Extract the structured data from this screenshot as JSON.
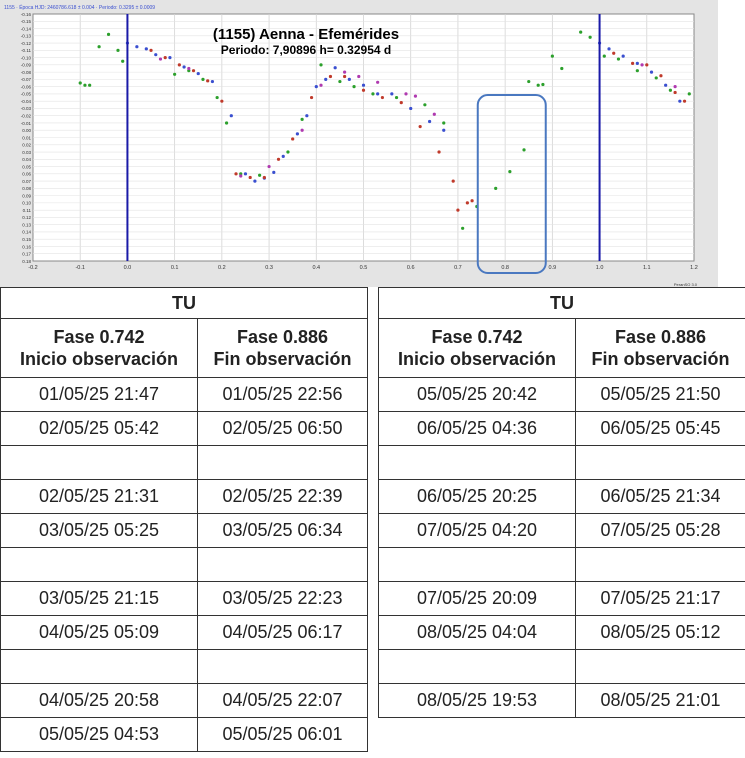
{
  "chart_data": {
    "type": "scatter",
    "title": "(1155) Aenna - Efemérides",
    "subtitle": "Periodo: 7,90896 h= 0.32954 d",
    "header_text": "1155 · Época HJD: 2460786.618 ± 0.004 · Periodo: 0.3295 ± 0.0009",
    "footer_text": "PeranSO 3.0",
    "xlim": [
      -0.2,
      1.2
    ],
    "ylim": [
      -0.16,
      0.18
    ],
    "x_ticks": [
      "-0.2",
      "-0.1",
      "0.0",
      "0.1",
      "0.2",
      "0.3",
      "0.4",
      "0.5",
      "0.6",
      "0.7",
      "0.8",
      "0.9",
      "1.0",
      "1.1",
      "1.2"
    ],
    "y_ticks": [
      "-0.16",
      "-0.15",
      "-0.14",
      "-0.13",
      "-0.12",
      "-0.11",
      "-0.10",
      "-0.09",
      "-0.08",
      "-0.07",
      "-0.06",
      "-0.05",
      "-0.04",
      "-0.03",
      "-0.02",
      "-0.01",
      "0.00",
      "0.01",
      "0.02",
      "0.03",
      "0.04",
      "0.05",
      "0.06",
      "0.07",
      "0.08",
      "0.09",
      "0.10",
      "0.11",
      "0.12",
      "0.13",
      "0.14",
      "0.15",
      "0.16",
      "0.17",
      "0.18"
    ],
    "vertical_lines": [
      0.0,
      1.0
    ],
    "highlight_box": {
      "x": [
        0.742,
        0.886
      ]
    },
    "grid": true,
    "series": [
      {
        "color": "#3a4fd0",
        "x": [
          0.0,
          0.02,
          0.04,
          0.06,
          0.09,
          0.12,
          0.15,
          0.18,
          0.22,
          0.25,
          0.27,
          0.29,
          0.31,
          0.33,
          0.36,
          0.38,
          0.4,
          0.42,
          0.44,
          0.47,
          0.5,
          0.53,
          0.56,
          0.6,
          0.64,
          0.67,
          1.0,
          1.02,
          1.05,
          1.08,
          1.11,
          1.14,
          1.17
        ],
        "y": [
          -0.12,
          -0.115,
          -0.112,
          -0.104,
          -0.1,
          -0.087,
          -0.078,
          -0.067,
          -0.02,
          0.06,
          0.07,
          0.066,
          0.058,
          0.036,
          0.005,
          -0.02,
          -0.06,
          -0.07,
          -0.086,
          -0.07,
          -0.062,
          -0.05,
          -0.05,
          -0.03,
          -0.012,
          0.0,
          -0.12,
          -0.112,
          -0.102,
          -0.092,
          -0.08,
          -0.062,
          -0.04
        ]
      },
      {
        "color": "#c03a2b",
        "x": [
          0.05,
          0.08,
          0.11,
          0.14,
          0.17,
          0.2,
          0.23,
          0.26,
          0.29,
          0.32,
          0.35,
          0.39,
          0.43,
          0.46,
          0.5,
          0.54,
          0.58,
          0.62,
          0.66,
          0.69,
          0.7,
          0.72,
          0.73,
          1.03,
          1.07,
          1.1,
          1.13,
          1.16,
          1.18
        ],
        "y": [
          -0.11,
          -0.1,
          -0.09,
          -0.082,
          -0.068,
          -0.04,
          0.06,
          0.065,
          0.065,
          0.04,
          0.012,
          -0.045,
          -0.074,
          -0.074,
          -0.055,
          -0.045,
          -0.038,
          -0.005,
          0.03,
          0.07,
          0.11,
          0.1,
          0.097,
          -0.106,
          -0.092,
          -0.09,
          -0.075,
          -0.052,
          -0.04
        ]
      },
      {
        "color": "#2ca02c",
        "x": [
          -0.1,
          -0.09,
          -0.08,
          -0.06,
          -0.04,
          -0.02,
          -0.01,
          0.1,
          0.13,
          0.16,
          0.19,
          0.21,
          0.24,
          0.28,
          0.34,
          0.37,
          0.41,
          0.45,
          0.48,
          0.52,
          0.57,
          0.63,
          0.67,
          0.71,
          0.74,
          0.78,
          0.81,
          0.84,
          0.85,
          0.87,
          0.88,
          0.9,
          0.92,
          0.96,
          0.98,
          1.01,
          1.04,
          1.08,
          1.12,
          1.15,
          1.19
        ],
        "y": [
          -0.065,
          -0.062,
          -0.062,
          -0.115,
          -0.132,
          -0.11,
          -0.095,
          -0.077,
          -0.082,
          -0.07,
          -0.045,
          -0.01,
          0.06,
          0.062,
          0.03,
          -0.015,
          -0.09,
          -0.067,
          -0.06,
          -0.05,
          -0.045,
          -0.035,
          -0.01,
          0.135,
          0.105,
          0.08,
          0.057,
          0.027,
          -0.067,
          -0.062,
          -0.063,
          -0.102,
          -0.085,
          -0.135,
          -0.128,
          -0.102,
          -0.098,
          -0.082,
          -0.072,
          -0.055,
          -0.05
        ]
      },
      {
        "color": "#b03ab0",
        "x": [
          0.07,
          0.13,
          0.24,
          0.3,
          0.37,
          0.41,
          0.46,
          0.49,
          0.53,
          0.59,
          0.61,
          0.65,
          1.09,
          1.16
        ],
        "y": [
          -0.098,
          -0.085,
          0.063,
          0.05,
          0.0,
          -0.062,
          -0.08,
          -0.074,
          -0.066,
          -0.05,
          -0.047,
          -0.022,
          -0.09,
          -0.06
        ]
      }
    ]
  },
  "tables": {
    "left": {
      "title": "TU",
      "col1": {
        "line1": "Fase 0.742",
        "line2": "Inicio observación"
      },
      "col2": {
        "line1": "Fase 0.886",
        "line2": "Fin observación"
      },
      "rows": [
        [
          "01/05/25 21:47",
          "01/05/25 22:56"
        ],
        [
          "02/05/25 05:42",
          "02/05/25 06:50"
        ],
        [
          "",
          ""
        ],
        [
          "02/05/25 21:31",
          "02/05/25 22:39"
        ],
        [
          "03/05/25 05:25",
          "03/05/25 06:34"
        ],
        [
          "",
          ""
        ],
        [
          "03/05/25 21:15",
          "03/05/25 22:23"
        ],
        [
          "04/05/25 05:09",
          "04/05/25 06:17"
        ],
        [
          "",
          ""
        ],
        [
          "04/05/25 20:58",
          "04/05/25 22:07"
        ],
        [
          "05/05/25 04:53",
          "05/05/25 06:01"
        ]
      ]
    },
    "right": {
      "title": "TU",
      "col1": {
        "line1": "Fase 0.742",
        "line2": "Inicio observación"
      },
      "col2": {
        "line1": "Fase 0.886",
        "line2": "Fin observación"
      },
      "rows": [
        [
          "05/05/25 20:42",
          "05/05/25 21:50"
        ],
        [
          "06/05/25 04:36",
          "06/05/25 05:45"
        ],
        [
          "",
          ""
        ],
        [
          "06/05/25 20:25",
          "06/05/25 21:34"
        ],
        [
          "07/05/25 04:20",
          "07/05/25 05:28"
        ],
        [
          "",
          ""
        ],
        [
          "07/05/25 20:09",
          "07/05/25 21:17"
        ],
        [
          "08/05/25 04:04",
          "08/05/25 05:12"
        ],
        [
          "",
          ""
        ],
        [
          "08/05/25 19:53",
          "08/05/25 21:01"
        ]
      ]
    }
  }
}
